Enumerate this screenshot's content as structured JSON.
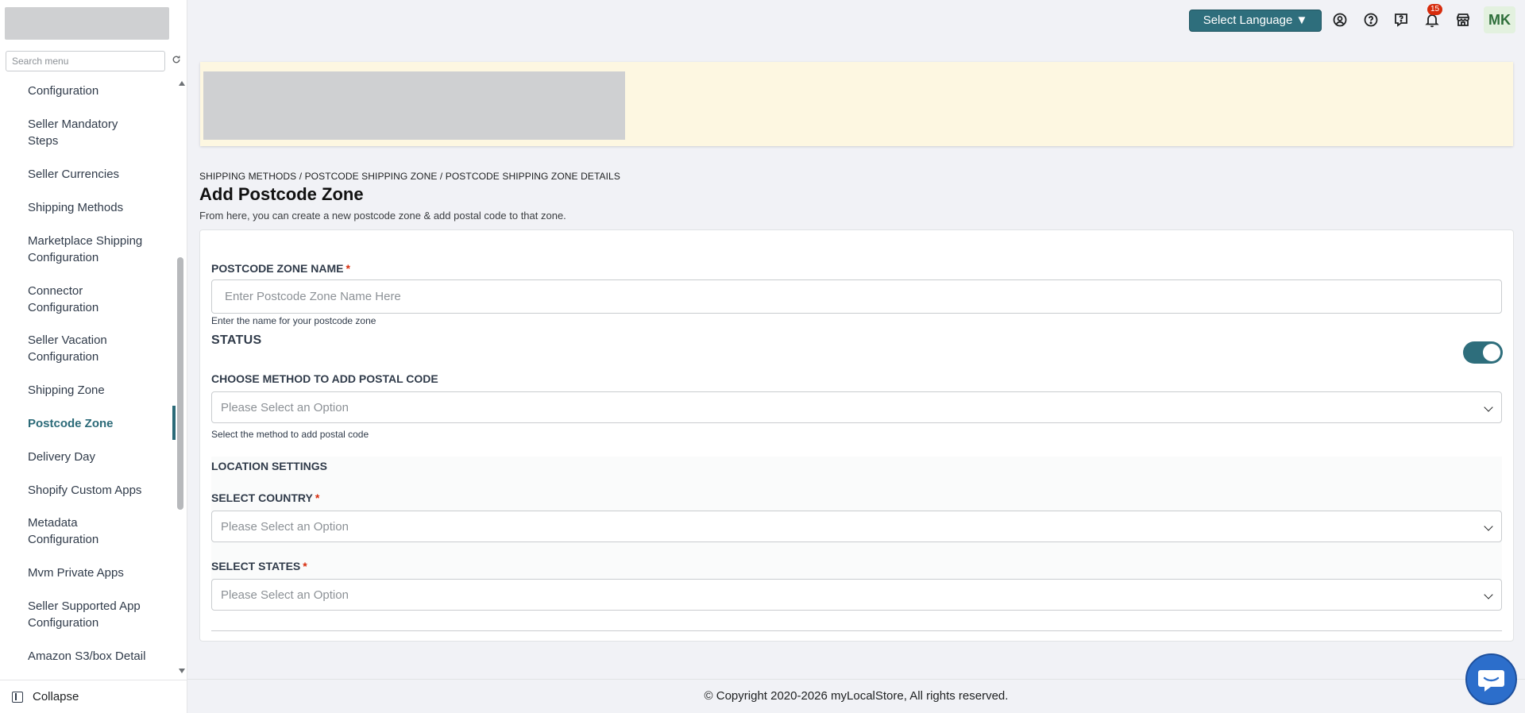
{
  "sidebar": {
    "search_placeholder": "Search menu",
    "items": [
      {
        "label": "Configuration"
      },
      {
        "label": "Seller Mandatory Steps"
      },
      {
        "label": "Seller Currencies"
      },
      {
        "label": "Shipping Methods"
      },
      {
        "label": "Marketplace Shipping Configuration"
      },
      {
        "label": "Connector Configuration"
      },
      {
        "label": "Seller Vacation Configuration"
      },
      {
        "label": "Shipping Zone"
      },
      {
        "label": "Postcode Zone"
      },
      {
        "label": "Delivery Day"
      },
      {
        "label": "Shopify Custom Apps"
      },
      {
        "label": "Metadata Configuration"
      },
      {
        "label": "Mvm Private Apps"
      },
      {
        "label": "Seller Supported App Configuration"
      },
      {
        "label": "Amazon S3/box Detail"
      }
    ],
    "active_item": "Postcode Zone",
    "collapse_label": "Collapse"
  },
  "header": {
    "language_button": "Select Language ▼",
    "notification_count": "15",
    "avatar_initials": "MK",
    "icons": [
      "user-circle-icon",
      "help-icon",
      "feedback-icon",
      "bell-icon",
      "store-icon"
    ]
  },
  "page": {
    "breadcrumb": "SHIPPING METHODS / POSTCODE SHIPPING ZONE / POSTCODE SHIPPING ZONE DETAILS",
    "title": "Add Postcode Zone",
    "subtitle": "From here, you can create a new postcode zone & add postal code to that zone."
  },
  "form": {
    "zone_name": {
      "label": "POSTCODE ZONE NAME",
      "required_mark": "*",
      "placeholder": "Enter Postcode Zone Name Here",
      "value": "",
      "help": "Enter the name for your postcode zone"
    },
    "status": {
      "label": "STATUS",
      "enabled": true
    },
    "method": {
      "label": "CHOOSE METHOD TO ADD POSTAL CODE",
      "placeholder": "Please Select an Option",
      "help": "Select the method to add postal code"
    },
    "location_settings": {
      "title": "LOCATION SETTINGS",
      "country": {
        "label": "SELECT COUNTRY",
        "required_mark": "*",
        "placeholder": "Please Select an Option"
      },
      "states": {
        "label": "SELECT STATES",
        "required_mark": "*",
        "placeholder": "Please Select an Option"
      }
    }
  },
  "footer": {
    "copyright": "© Copyright 2020-2026 myLocalStore, All rights reserved."
  },
  "colors": {
    "accent": "#2e6e7c",
    "banner": "#fdf7e1",
    "required": "#d72c0d",
    "chat": "#2c6ecb"
  }
}
